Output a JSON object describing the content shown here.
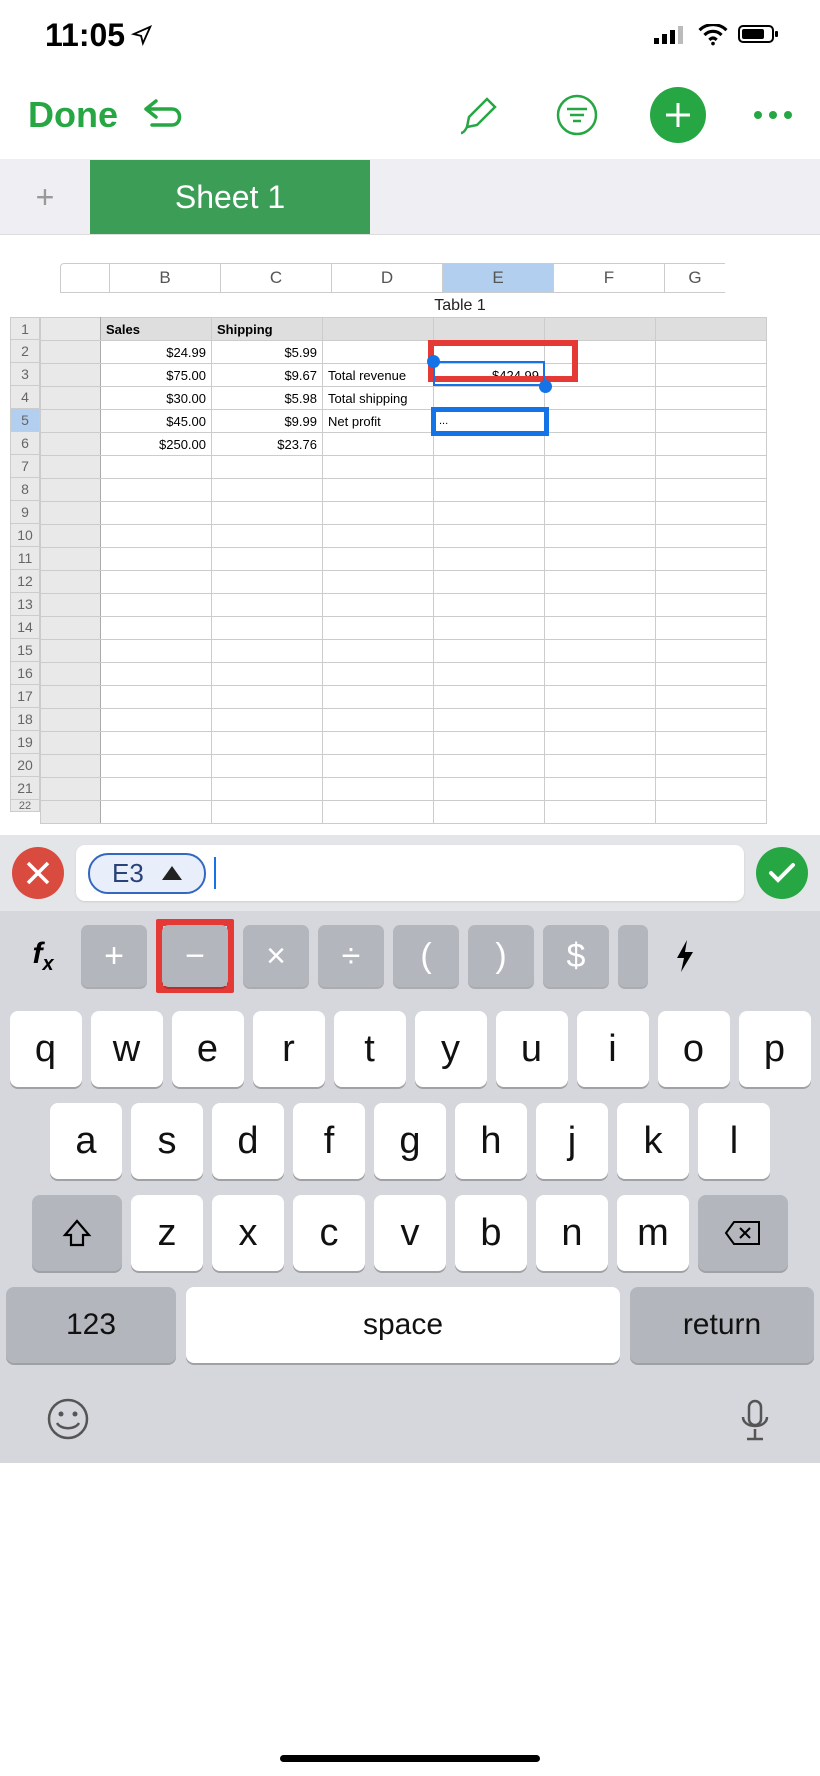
{
  "status": {
    "time": "11:05"
  },
  "toolbar": {
    "done": "Done"
  },
  "sheet": {
    "tab": "Sheet 1",
    "table_title": "Table 1"
  },
  "columns": [
    "B",
    "C",
    "D",
    "E",
    "F",
    "G"
  ],
  "headers": {
    "b": "Sales",
    "c": "Shipping"
  },
  "rows": [
    {
      "b": "$24.99",
      "c": "$5.99",
      "d": "",
      "e": ""
    },
    {
      "b": "$75.00",
      "c": "$9.67",
      "d": "Total  revenue",
      "e": "$424.99"
    },
    {
      "b": "$30.00",
      "c": "$5.98",
      "d": "Total shipping",
      "e": ""
    },
    {
      "b": "$45.00",
      "c": "$9.99",
      "d": "Net profit",
      "e": "..."
    },
    {
      "b": "$250.00",
      "c": "$23.76",
      "d": "",
      "e": ""
    }
  ],
  "formula": {
    "ref": "E3"
  },
  "operators": [
    "+",
    "−",
    "×",
    "÷",
    "(",
    ")",
    "$"
  ],
  "keyboard": {
    "r1": [
      "q",
      "w",
      "e",
      "r",
      "t",
      "y",
      "u",
      "i",
      "o",
      "p"
    ],
    "r2": [
      "a",
      "s",
      "d",
      "f",
      "g",
      "h",
      "j",
      "k",
      "l"
    ],
    "r3": [
      "z",
      "x",
      "c",
      "v",
      "b",
      "n",
      "m"
    ],
    "num": "123",
    "space": "space",
    "return": "return"
  },
  "selected_column": "E",
  "selected_row": 5,
  "highlight": {
    "minus_key": true,
    "cell": "E3"
  }
}
